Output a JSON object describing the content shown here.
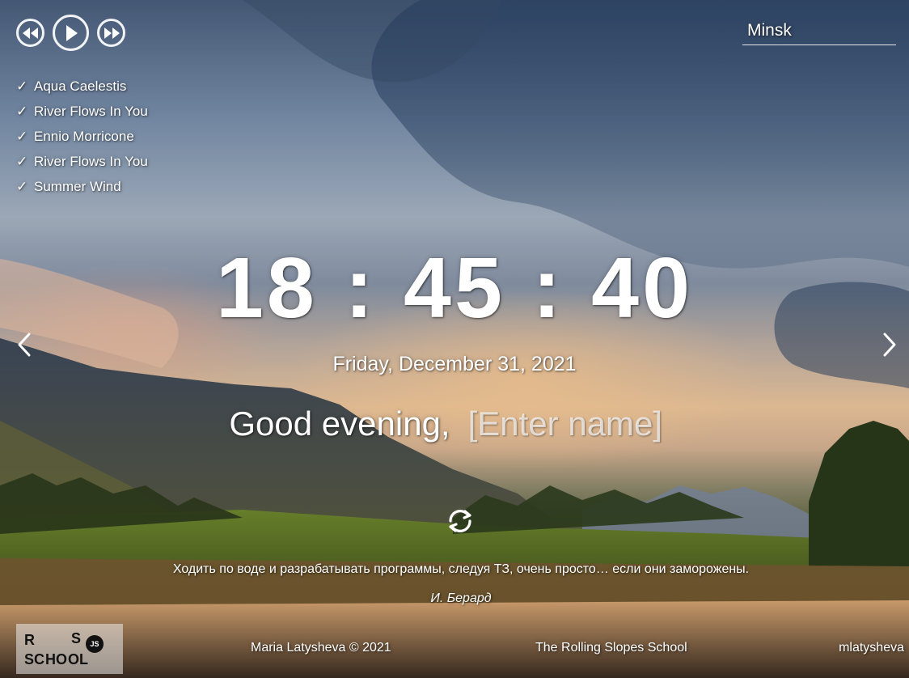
{
  "colors": {
    "text": "#ffffff",
    "logo_background": "#e6e6e6",
    "logo_text": "#111111"
  },
  "player": {
    "controls": {
      "prev_icon": "rewind-icon",
      "play_icon": "play-icon",
      "next_icon": "fast-forward-icon"
    },
    "check_icon": "check-icon",
    "playlist": [
      {
        "title": "Aqua Caelestis"
      },
      {
        "title": "River Flows In You"
      },
      {
        "title": "Ennio Morricone"
      },
      {
        "title": "River Flows In You"
      },
      {
        "title": "Summer Wind"
      }
    ]
  },
  "weather": {
    "city": "Minsk"
  },
  "clock": {
    "time": "18:45:40",
    "date": "Friday, December 31, 2021"
  },
  "greeting": {
    "text": "Good evening,",
    "name_placeholder": "[Enter name]",
    "name_value": ""
  },
  "slider": {
    "prev_icon": "chevron-left-icon",
    "next_icon": "chevron-right-icon"
  },
  "quote": {
    "refresh_icon": "refresh-icon",
    "text": "Ходить по воде и разрабатывать программы, следуя ТЗ, очень просто… если они заморожены.",
    "author": "И. Берард"
  },
  "footer": {
    "logo": {
      "top_left": "R",
      "top_right": "S",
      "bottom": "SC HO OL",
      "badge": "JS"
    },
    "copyright": "Maria Latysheva © 2021",
    "school": "The Rolling Slopes School",
    "github": "mlatysheva"
  }
}
